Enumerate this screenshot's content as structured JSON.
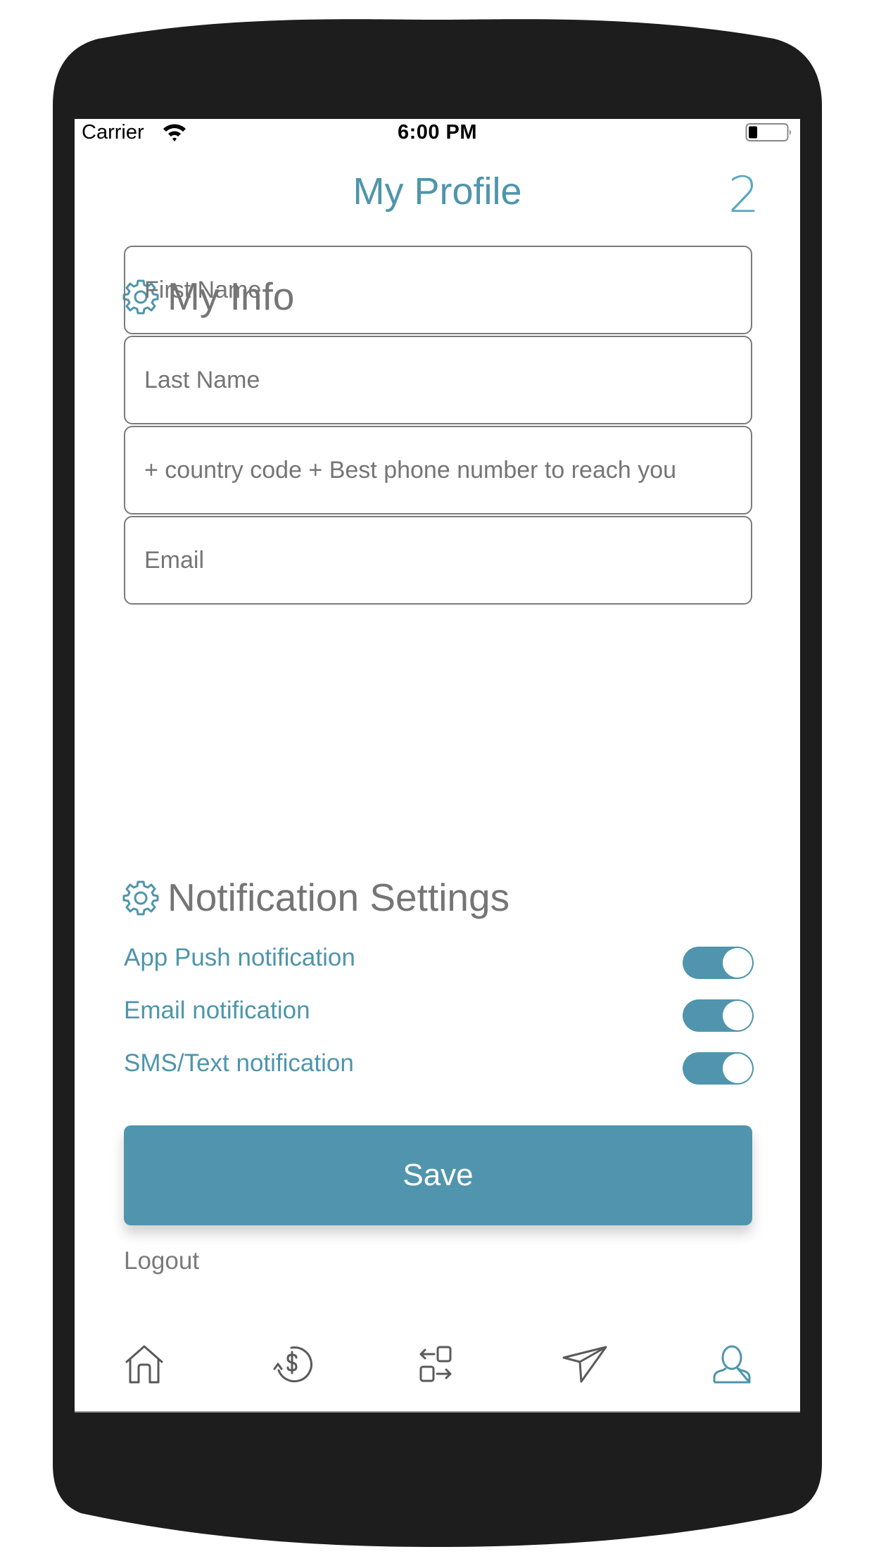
{
  "status_bar": {
    "carrier": "Carrier",
    "time": "6:00 PM",
    "wifi_icon": "wifi-icon",
    "battery_icon": "battery-low-icon"
  },
  "header": {
    "title": "My Profile",
    "help_icon": "help-icon",
    "help_glyph": "2"
  },
  "my_info": {
    "heading": "My Info",
    "icon": "gear-icon",
    "fields": [
      {
        "name": "first-name",
        "placeholder": "First Name",
        "value": ""
      },
      {
        "name": "last-name",
        "placeholder": "Last Name",
        "value": ""
      },
      {
        "name": "phone",
        "placeholder": "+ country code + Best phone number to reach you",
        "value": ""
      },
      {
        "name": "email",
        "placeholder": "Email",
        "value": ""
      }
    ]
  },
  "notifications": {
    "heading": "Notification Settings",
    "icon": "gear-icon",
    "items": [
      {
        "label": "App Push notification",
        "enabled": true
      },
      {
        "label": "Email notification",
        "enabled": true
      },
      {
        "label": "SMS/Text notification",
        "enabled": true
      }
    ]
  },
  "actions": {
    "save_label": "Save",
    "logout_label": "Logout"
  },
  "bottom_nav": {
    "items": [
      {
        "icon": "home-icon",
        "active": false
      },
      {
        "icon": "dollar-refresh-icon",
        "active": false
      },
      {
        "icon": "transfer-icon",
        "active": false
      },
      {
        "icon": "send-icon",
        "active": false
      },
      {
        "icon": "profile-icon",
        "active": true
      }
    ]
  },
  "colors": {
    "accent": "#5095ad",
    "text_gray": "#757575",
    "frame": "#1d1d1d",
    "icon_inactive": "#5a5a5a"
  }
}
